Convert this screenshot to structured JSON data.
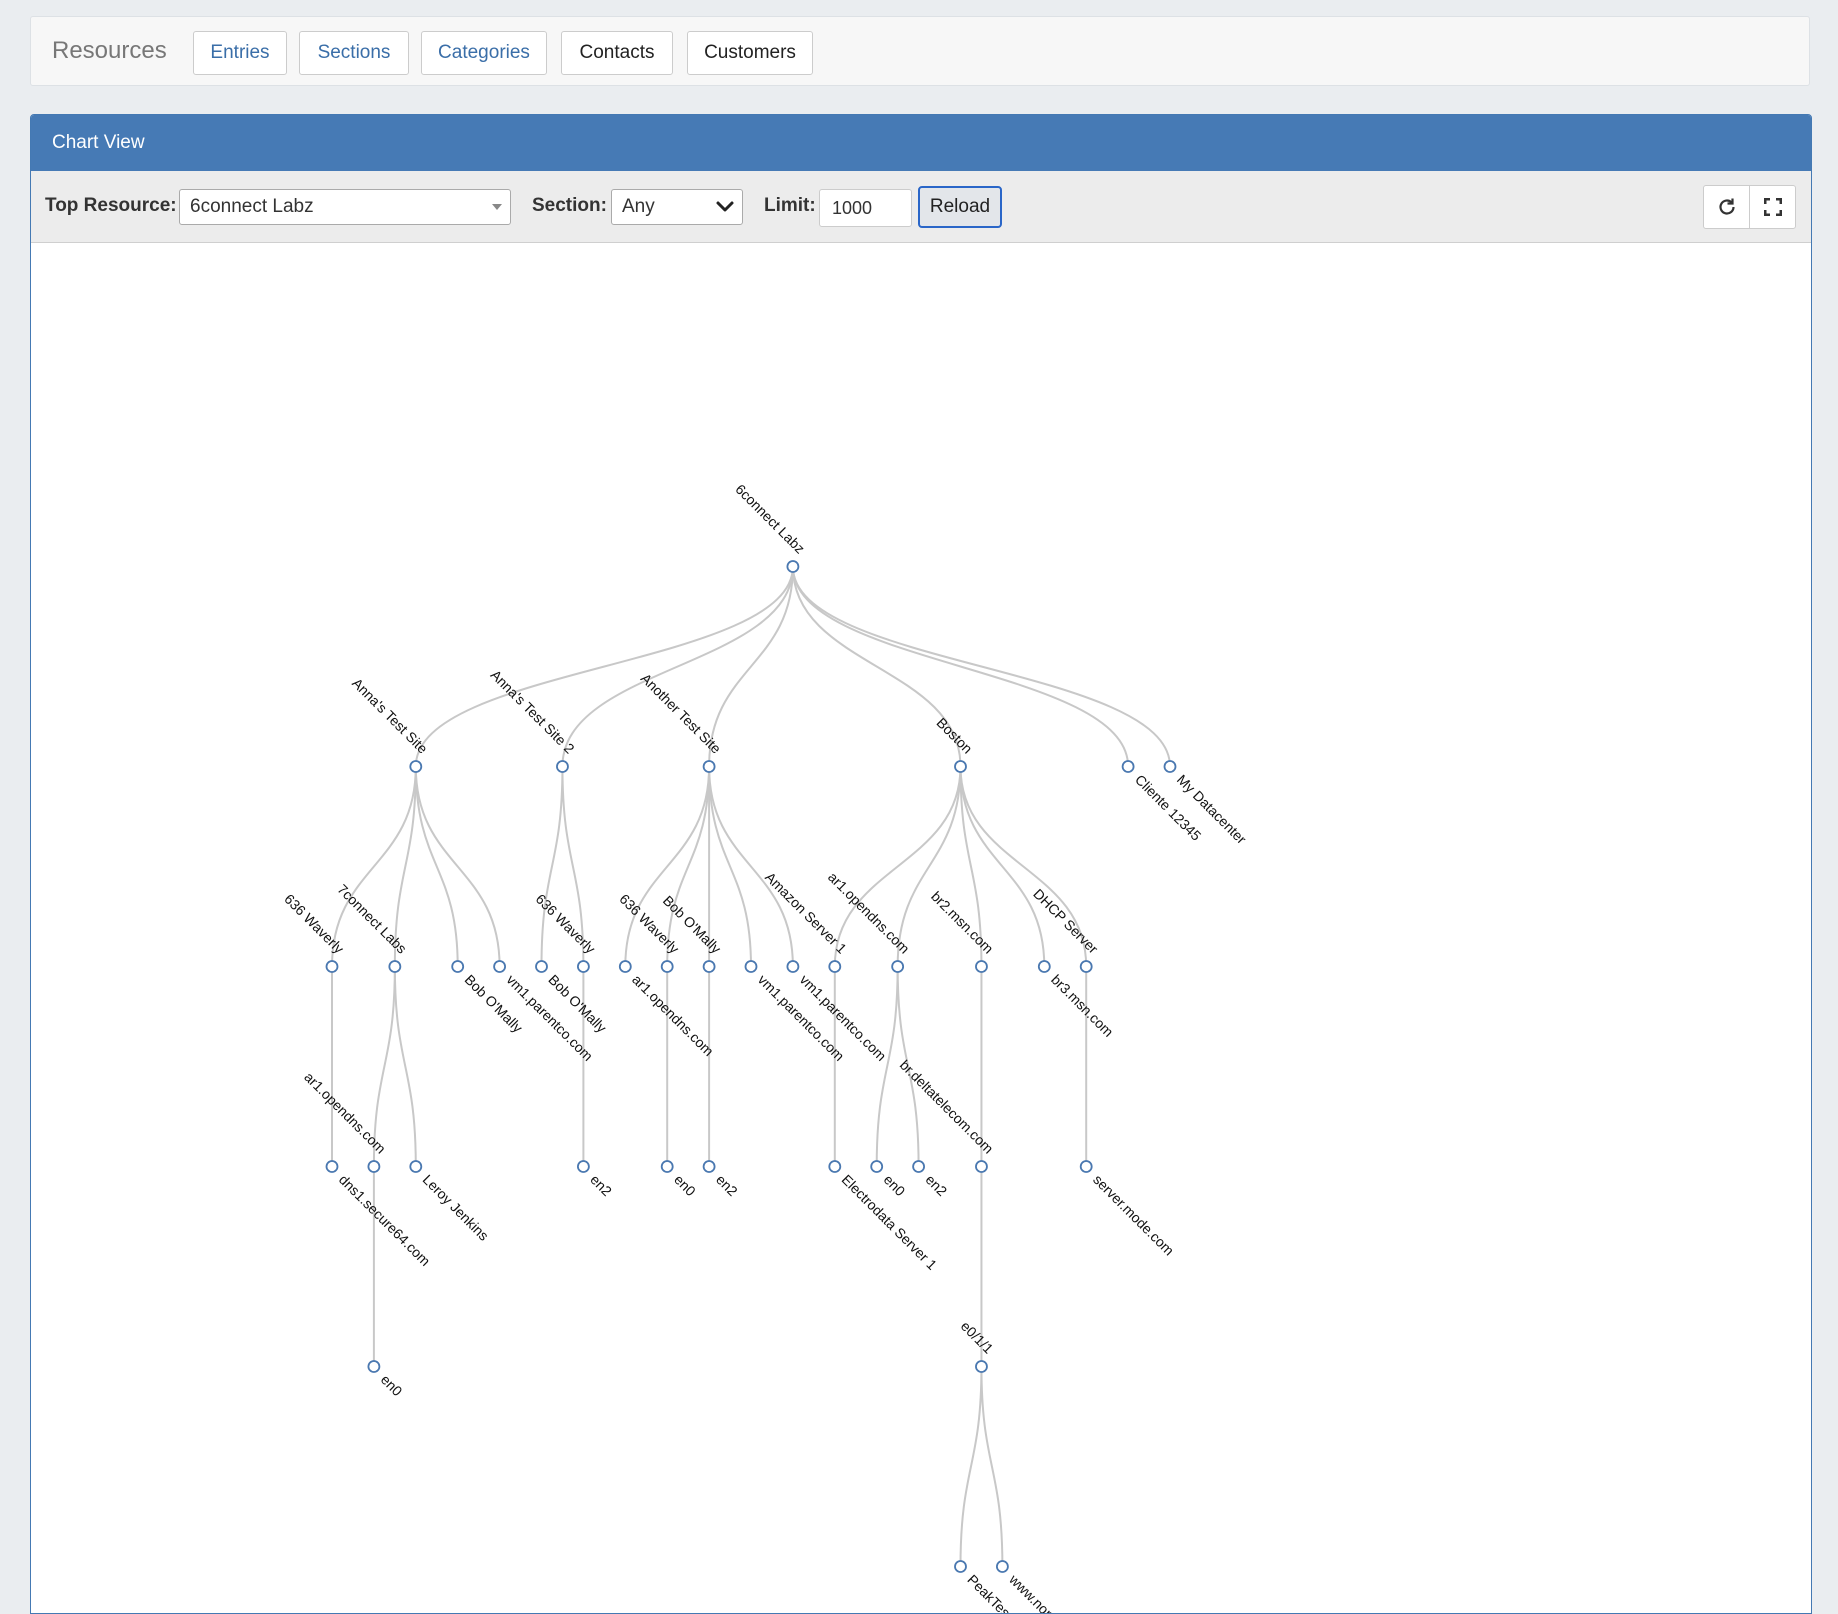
{
  "header": {
    "brand": "Resources",
    "nav": [
      {
        "label": "Entries"
      },
      {
        "label": "Sections"
      },
      {
        "label": "Categories"
      },
      {
        "label": "Contacts"
      },
      {
        "label": "Customers"
      }
    ]
  },
  "panel": {
    "title": "Chart View",
    "toolbar": {
      "top_resource_label": "Top Resource:",
      "top_resource_value": "6connect Labz",
      "section_label": "Section:",
      "section_value": "Any",
      "limit_label": "Limit:",
      "limit_value": "1000",
      "reload_label": "Reload",
      "refresh_icon": "refresh-icon",
      "fullscreen_icon": "fullscreen-icon"
    }
  },
  "colors": {
    "accent": "#467ab5",
    "link": "#3a6ea8",
    "node_stroke": "#4a78b0",
    "edge": "#c8c8c8"
  },
  "tree": {
    "name": "6connect Labz",
    "children": [
      {
        "name": "Anna's Test Site",
        "children": [
          {
            "name": "636 Waverly",
            "children": [
              {
                "name": "dns1.secure64.com"
              }
            ]
          },
          {
            "name": "7connect Labs",
            "children": [
              {
                "name": "ar1.opendns.com",
                "children": [
                  {
                    "name": "en0"
                  }
                ]
              },
              {
                "name": "Leroy Jenkins"
              }
            ]
          },
          {
            "name": "Bob O'Mally"
          },
          {
            "name": "vm1.parentco.com"
          }
        ]
      },
      {
        "name": "Anna's Test Site 2",
        "children": [
          {
            "name": "Bob O'Mally"
          },
          {
            "name": "636 Waverly",
            "children": [
              {
                "name": "en2"
              }
            ]
          }
        ]
      },
      {
        "name": "Another Test Site",
        "children": [
          {
            "name": "ar1.opendns.com"
          },
          {
            "name": "636 Waverly",
            "children": [
              {
                "name": "en0"
              }
            ]
          },
          {
            "name": "Bob O'Mally",
            "children": [
              {
                "name": "en2"
              }
            ]
          },
          {
            "name": "vm1.parentco.com"
          },
          {
            "name": "vm1.parentco.com"
          }
        ]
      },
      {
        "name": "Boston",
        "children": [
          {
            "name": "Amazon Server 1",
            "children": [
              {
                "name": "Electrodata Server 1"
              }
            ]
          },
          {
            "name": "ar1.opendns.com",
            "children": [
              {
                "name": "en0"
              },
              {
                "name": "en2"
              }
            ]
          },
          {
            "name": "br2.msn.com",
            "children": [
              {
                "name": "br.deltatelecom.com",
                "children": [
                  {
                    "name": "e0/1/1",
                    "children": [
                      {
                        "name": "PeakTestServer"
                      },
                      {
                        "name": "www.nominet.com"
                      }
                    ]
                  }
                ]
              }
            ]
          },
          {
            "name": "br3.msn.com"
          },
          {
            "name": "DHCP Server",
            "children": [
              {
                "name": "server.mode.com"
              }
            ]
          }
        ]
      },
      {
        "name": "Cliente 12345"
      },
      {
        "name": "My Datacenter"
      }
    ]
  }
}
